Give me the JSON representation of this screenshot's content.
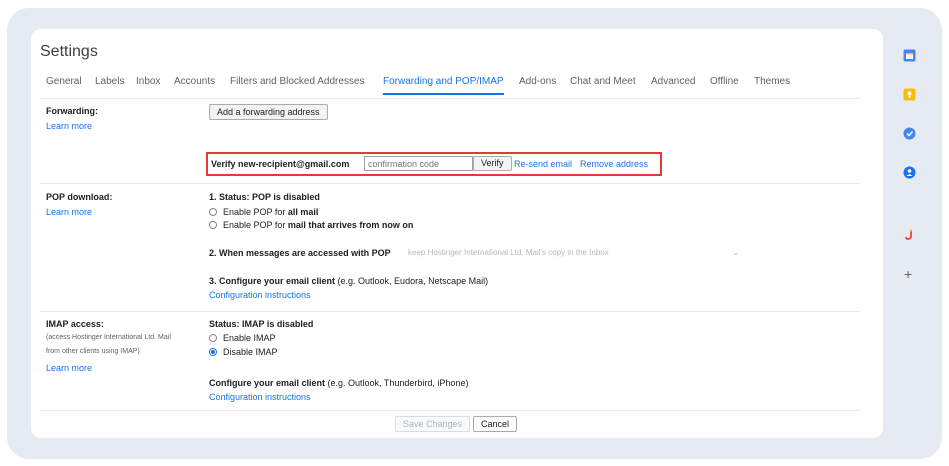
{
  "header": {
    "title": "Settings"
  },
  "tabs": [
    {
      "label": "General"
    },
    {
      "label": "Labels"
    },
    {
      "label": "Inbox"
    },
    {
      "label": "Accounts"
    },
    {
      "label": "Filters and Blocked Addresses"
    },
    {
      "label": "Forwarding and POP/IMAP"
    },
    {
      "label": "Add-ons"
    },
    {
      "label": "Chat and Meet"
    },
    {
      "label": "Advanced"
    },
    {
      "label": "Offline"
    },
    {
      "label": "Themes"
    }
  ],
  "active_tab": "Forwarding and POP/IMAP",
  "forwarding": {
    "label": "Forwarding:",
    "learn_more": "Learn more",
    "add_button": "Add a forwarding address",
    "verify_label": "Verify new-recipient@gmail.com",
    "code_placeholder": "confirmation code",
    "verify_button": "Verify",
    "resend_link": "Re-send email",
    "remove_link": "Remove address"
  },
  "pop": {
    "label": "POP download:",
    "learn_more": "Learn more",
    "status": "1. Status: POP is disabled",
    "option1_prefix": "Enable POP for ",
    "option1_bold": "all mail",
    "option2_prefix": "Enable POP for ",
    "option2_bold": "mail that arrives from now on",
    "when_accessed": "2. When messages are accessed with POP",
    "when_accessed_value": "keep Hostinger International Ltd. Mail's copy in the Inbox",
    "configure_bold": "3. Configure your email client",
    "configure_rest": " (e.g. Outlook, Eudora, Netscape Mail)",
    "config_link": "Configuration instructions"
  },
  "imap": {
    "label": "IMAP access:",
    "sub1": "(access Hostinger International Ltd. Mail",
    "sub2": "from other clients using IMAP)",
    "learn_more": "Learn more",
    "status": "Status: IMAP is disabled",
    "enable": "Enable IMAP",
    "disable": "Disable IMAP",
    "selected": "Disable IMAP",
    "configure_bold": "Configure your email client",
    "configure_rest": " (e.g. Outlook, Thunderbird, iPhone)",
    "config_link": "Configuration instructions"
  },
  "footer": {
    "save": "Save Changes",
    "cancel": "Cancel"
  },
  "sidebar_icons": [
    "calendar-icon",
    "keep-icon",
    "tasks-icon",
    "contacts-icon",
    "addon-icon",
    "plus-icon"
  ],
  "colors": {
    "accent": "#1a73e8",
    "highlight_border": "#e53935"
  }
}
